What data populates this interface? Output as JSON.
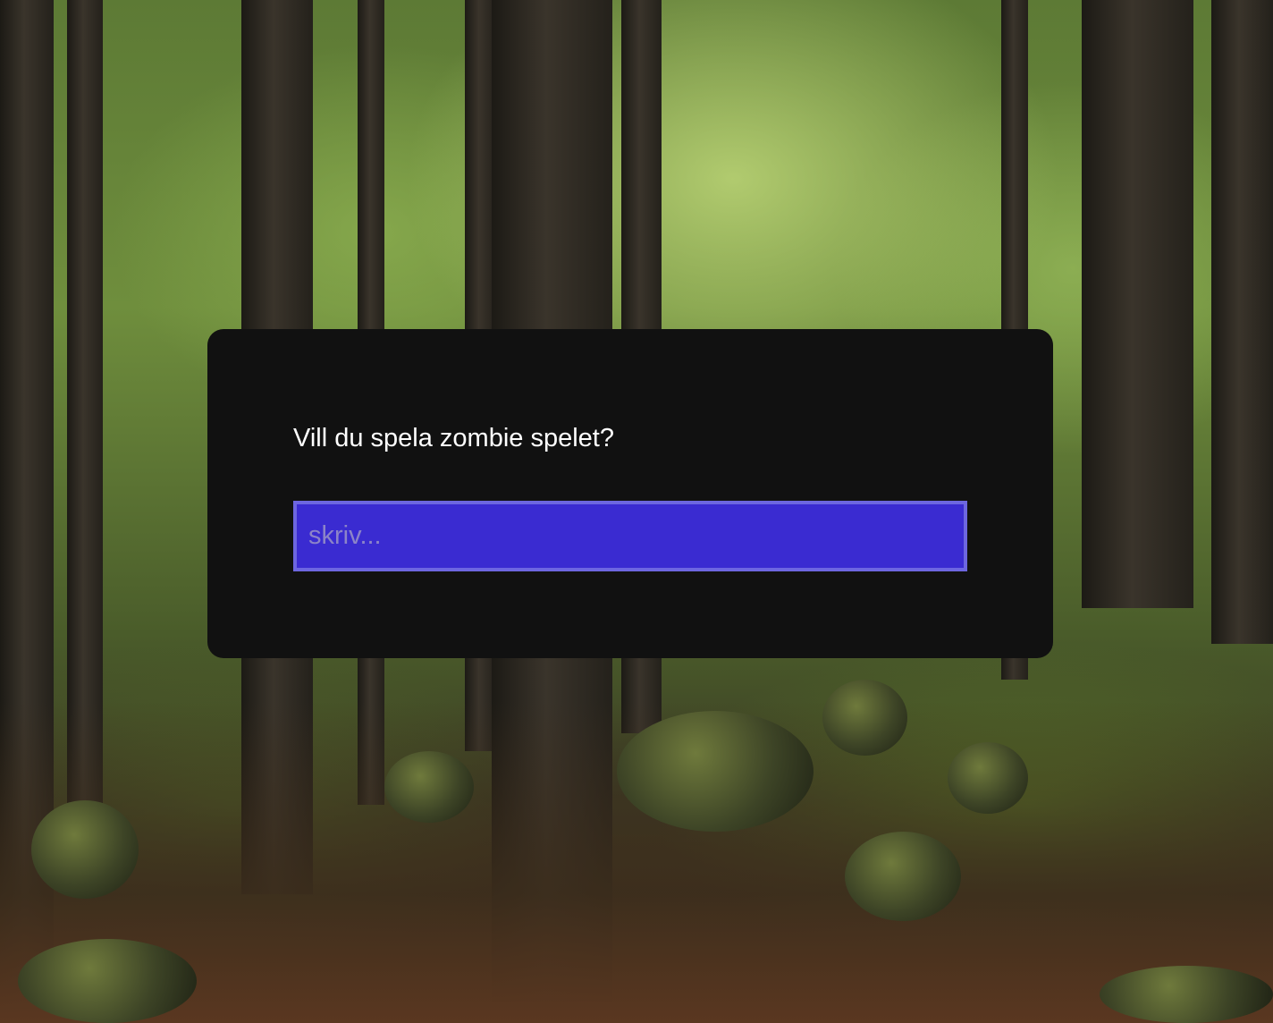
{
  "dialog": {
    "question": "Vill du spela zombie spelet?",
    "input": {
      "value": "",
      "placeholder": "skriv..."
    }
  },
  "colors": {
    "dialog_background": "#111111",
    "question_text": "#ffffff",
    "input_background": "#3a2bd1",
    "input_border": "#6d66e0",
    "placeholder_text": "#8c84c8"
  }
}
